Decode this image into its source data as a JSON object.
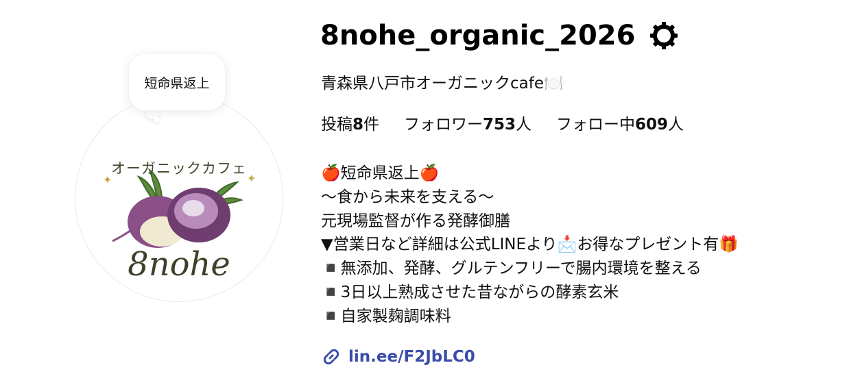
{
  "profile": {
    "username": "8nohe_organic_2026",
    "category": "青森県八戸市オーガニックcafe🍽️",
    "note": "短命県返上",
    "avatar": {
      "top_text": "オーガニックカフェ",
      "logo_text": "8nohe"
    }
  },
  "stats": {
    "posts_prefix": "投稿",
    "posts_count": "8",
    "posts_suffix": "件",
    "followers_prefix": "フォロワー",
    "followers_count": "753",
    "followers_suffix": "人",
    "following_prefix": "フォロー中",
    "following_count": "609",
    "following_suffix": "人"
  },
  "bio": {
    "lines": [
      "🍎短命県返上🍎",
      "〜食から未来を支える〜",
      "元現場監督が作る発酵御膳",
      "▼営業日など詳細は公式LINEより📩お得なプレゼント有🎁",
      "◾️無添加、発酵、グルテンフリーで腸内環境を整える",
      "◾️3日以上熟成させた昔ながらの酵素玄米",
      "◾️自家製麹調味料"
    ]
  },
  "link": {
    "text": "lin.ee/F2JbLC0"
  },
  "colors": {
    "link": "#3b4ca8",
    "text": "#111111",
    "avatar_border": "#e9e9e9"
  },
  "icons": {
    "settings": "gear-icon",
    "link": "link-icon"
  }
}
